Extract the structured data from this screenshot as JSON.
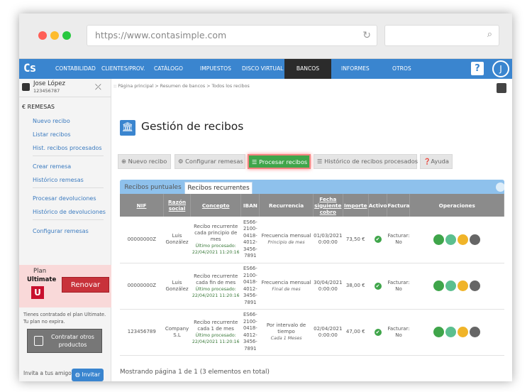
{
  "browser": {
    "url": "https://www.contasimple.com"
  },
  "nav": {
    "logo": "Cs",
    "items": [
      "CONTABILIDAD",
      "CLIENTES/PROV.",
      "CATÁLOGO",
      "IMPUESTOS",
      "DISCO VIRTUAL",
      "BANCOS",
      "INFORMES",
      "OTROS"
    ],
    "active": "BANCOS",
    "help": "?",
    "avatar": "J"
  },
  "sidebar": {
    "user_name": "Jose López",
    "user_id": "123456787",
    "section": "REMESAS",
    "links": [
      "Nuevo recibo",
      "Listar recibos",
      "Hist. recibos procesados",
      "Crear remesa",
      "Histórico remesas",
      "Procesar devoluciones",
      "Histórico de devoluciones",
      "Configurar remesas"
    ],
    "plan_label": "Plan",
    "plan_name": "Ultimate",
    "plan_badge": "U",
    "renew": "Renovar",
    "plan_note": "Tienes contratado el plan Ultimate. Tu plan no expira.",
    "contract": "Contratar otros productos",
    "invite_text": "Invita a tus amigos",
    "invite_button": "Invitar"
  },
  "main": {
    "breadcrumb": ":: Página principal > Resumen de bancos > Todos los recibos",
    "title": "Gestión de recibos",
    "toolbar": [
      "Nuevo recibo",
      "Configurar remesas",
      "Procesar recibos",
      "Histórico de recibos procesados",
      "Ayuda"
    ],
    "tabs": [
      "Recibos puntuales",
      "Recibos recurrentes"
    ],
    "columns": [
      "NIF",
      "Razón social",
      "Concepto",
      "IBAN",
      "Recurrencia",
      "Fecha siguiente cobro",
      "Importe",
      "Activo",
      "Factura",
      "Operaciones"
    ],
    "rows": [
      {
        "nif": "00000000Z",
        "razon": "Luis González",
        "concepto": "Recibo recurrente cada principio de mes",
        "proc": "Último procesado: 22/04/2021 11:20:16",
        "iban": "ES66- 2100- 0418- 4012- 3456- 7891",
        "recurrencia": "Frecuencia mensual",
        "recurrencia_sub": "Principio de mes",
        "fecha": "01/03/2021 0:00:00",
        "importe": "73,50 €",
        "factura": "Facturar: No"
      },
      {
        "nif": "00000000Z",
        "razon": "Luis González",
        "concepto": "Recibo recurrente cada fin de mes",
        "proc": "Último procesado: 22/04/2021 11:20:16",
        "iban": "ES66- 2100- 0418- 4012- 3456- 7891",
        "recurrencia": "Frecuencia mensual",
        "recurrencia_sub": "Final de mes",
        "fecha": "30/04/2021 0:00:00",
        "importe": "38,00 €",
        "factura": "Facturar: No"
      },
      {
        "nif": "123456789",
        "razon": "Company S.L",
        "concepto": "Recibo recurrente cada 1 de mes",
        "proc": "Último procesado: 22/04/2021 11:20:16",
        "iban": "ES66- 2100- 0418- 4012- 3456- 7891",
        "recurrencia": "Por intervalo de tiempo",
        "recurrencia_sub": "Cada 1 Meses",
        "fecha": "02/04/2021 0:00:00",
        "importe": "47,00 €",
        "factura": "Facturar: No"
      }
    ],
    "footer": "Mostrando página 1 de 1 (3 elementos en total)"
  },
  "colors": {
    "nav": "#3a85cf",
    "active_button": "#3fa54a",
    "renew": "#c8323a"
  }
}
